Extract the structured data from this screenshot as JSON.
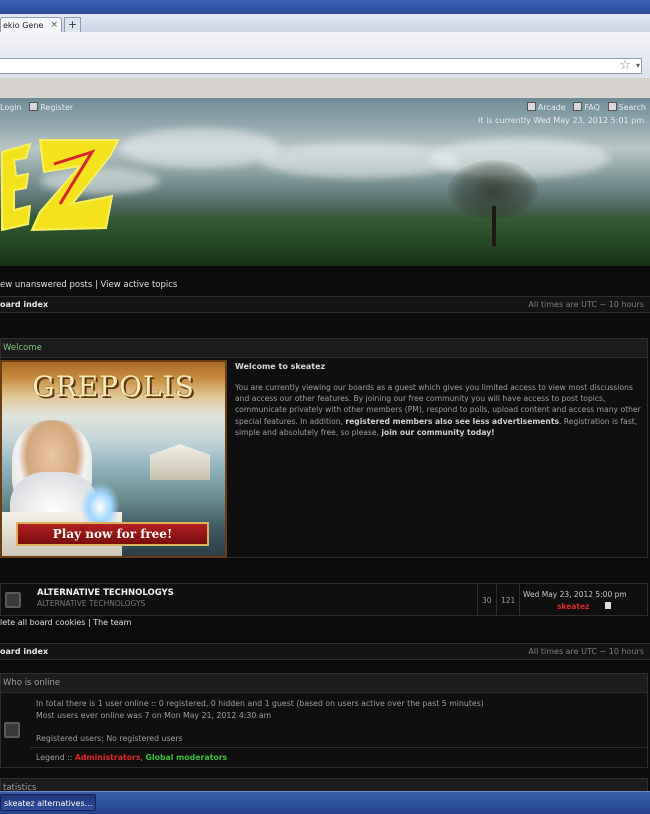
{
  "browser": {
    "tab_title": "ekio Gene",
    "tab_close": "×",
    "new_tab": "+",
    "star": "☆",
    "url_arrow": "▾"
  },
  "header": {
    "links_left": [
      "Login",
      "Register"
    ],
    "links_right": [
      "Arcade",
      "FAQ",
      "Search"
    ],
    "current_time": "It is currently Wed May 23, 2012 5:01 pm",
    "view_links": "ew unanswered posts | View active topics"
  },
  "index_bar": {
    "left": "oard index",
    "right": "All times are UTC − 10 hours"
  },
  "welcome": {
    "heading": "Welcome",
    "title": "Welcome to skeatez",
    "text_main": "You are currently viewing our boards as a guest which gives you limited access to view most discussions and access our other features. By joining our free community you will have access to post topics, communicate privately with other members (PM), respond to polls, upload content and access many other special features. In addition, ",
    "text_bold1": "registered members also see less advertisements",
    "text_mid": ". Registration is fast, simple and absolutely free, so please, ",
    "text_bold2": "join our community today!",
    "ad_title": "GREPOLIS",
    "ad_button": "Play now for free!"
  },
  "forum": {
    "title": "ALTERNATIVE TECHNOLOGYS",
    "description": "ALTERNATIVE TECHNOLOGYS",
    "topics": "30",
    "posts": "121",
    "last_post_date": "Wed May 23, 2012 5:00 pm",
    "last_post_user": "skeatez"
  },
  "footer_links": "lete all board cookies | The team",
  "index_bar2": {
    "left": "oard index",
    "right": "All times are UTC − 10 hours"
  },
  "who_online": {
    "heading": "Who is online",
    "line1": "In total there is 1 user online :: 0 registered, 0 hidden and 1 guest (based on users active over the past 5 minutes)",
    "line2": "Most users ever online was 7 on Mon May 21, 2012 4:30 am",
    "line3": "Registered users: No registered users",
    "legend_label": "Legend :: ",
    "legend_admin": "Administrators",
    "legend_sep": ", ",
    "legend_gmod": "Global moderators"
  },
  "statistics": {
    "heading": "tatistics"
  },
  "taskbar": {
    "button": "skeatez alternatives..."
  }
}
